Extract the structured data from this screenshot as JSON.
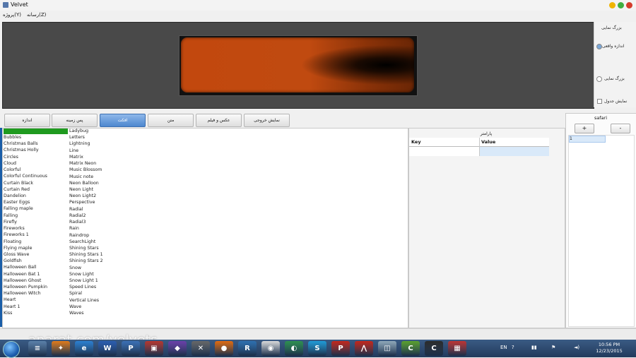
{
  "window": {
    "title": "Velvet"
  },
  "menu": {
    "items": [
      "رسانه(Z)",
      "پروژه(Y)"
    ]
  },
  "options": {
    "fullscreen_label": "بزرگ نمایی",
    "real_size_label": "اندازه واقعی",
    "zoom_label": "بزرگ نمایی",
    "show_table_label": "نمایش جدول"
  },
  "tabs": [
    "اندازه",
    "پس زمینه",
    "افکت",
    "متن",
    "عکس و فیلم",
    "نمایش خروجی"
  ],
  "effects": {
    "col1": [
      "Bubbles",
      "Christmas Balls",
      "Christmas Holly",
      "Circles",
      "Cloud",
      "Colorful",
      "Colorful Continuous",
      "Curtain Black",
      "Curtain Red",
      "Dandelion",
      "Easter Eggs",
      "Falling maple",
      "Falling",
      "Firefly",
      "Fireworks",
      "Fireworks 1",
      "Floating",
      "Flying maple",
      "Gloss Wave",
      "Goldfish",
      "Halloween Ball",
      "Halloween Bat 1",
      "Halloween Ghost",
      "Halloween Pumpkin",
      "Halloween Witch",
      "Heart",
      "Heart 1",
      "Kiss"
    ],
    "col2": [
      "Ladybug",
      "Letters",
      "Lightning",
      "Line",
      "Matrix",
      "Matrix Neon",
      "Music Blossom",
      "Music note",
      "Neon Balloon",
      "Neon Light",
      "Neon Light2",
      "Perspective",
      "Radial",
      "Radial2",
      "Radial3",
      "Rain",
      "Raindrop",
      "SearchLight",
      "Shining Stars",
      "Shining Stars 1",
      "Shining Stars 2",
      "Snow",
      "Snow Light",
      "Snow Light 1",
      "Speed Lines",
      "Spiral",
      "Vertical Lines",
      "Wave",
      "Waves"
    ]
  },
  "params": {
    "title": "پارامتر",
    "key_header": "Key",
    "value_header": "Value"
  },
  "safari": {
    "title": "safari",
    "add": "+",
    "remove": "-",
    "row": "1"
  },
  "watermark": "aparat.com/velvets",
  "taskbar": {
    "apps": [
      "≡",
      "✦",
      "e",
      "W",
      "P",
      "▣",
      "◆",
      "✕",
      "●",
      "R",
      "◉",
      "◐",
      "S",
      "P",
      "⋀",
      "◫",
      "C",
      "C",
      "▦"
    ],
    "lang": "EN",
    "time": "10:56 PM",
    "date": "12/23/2015"
  }
}
